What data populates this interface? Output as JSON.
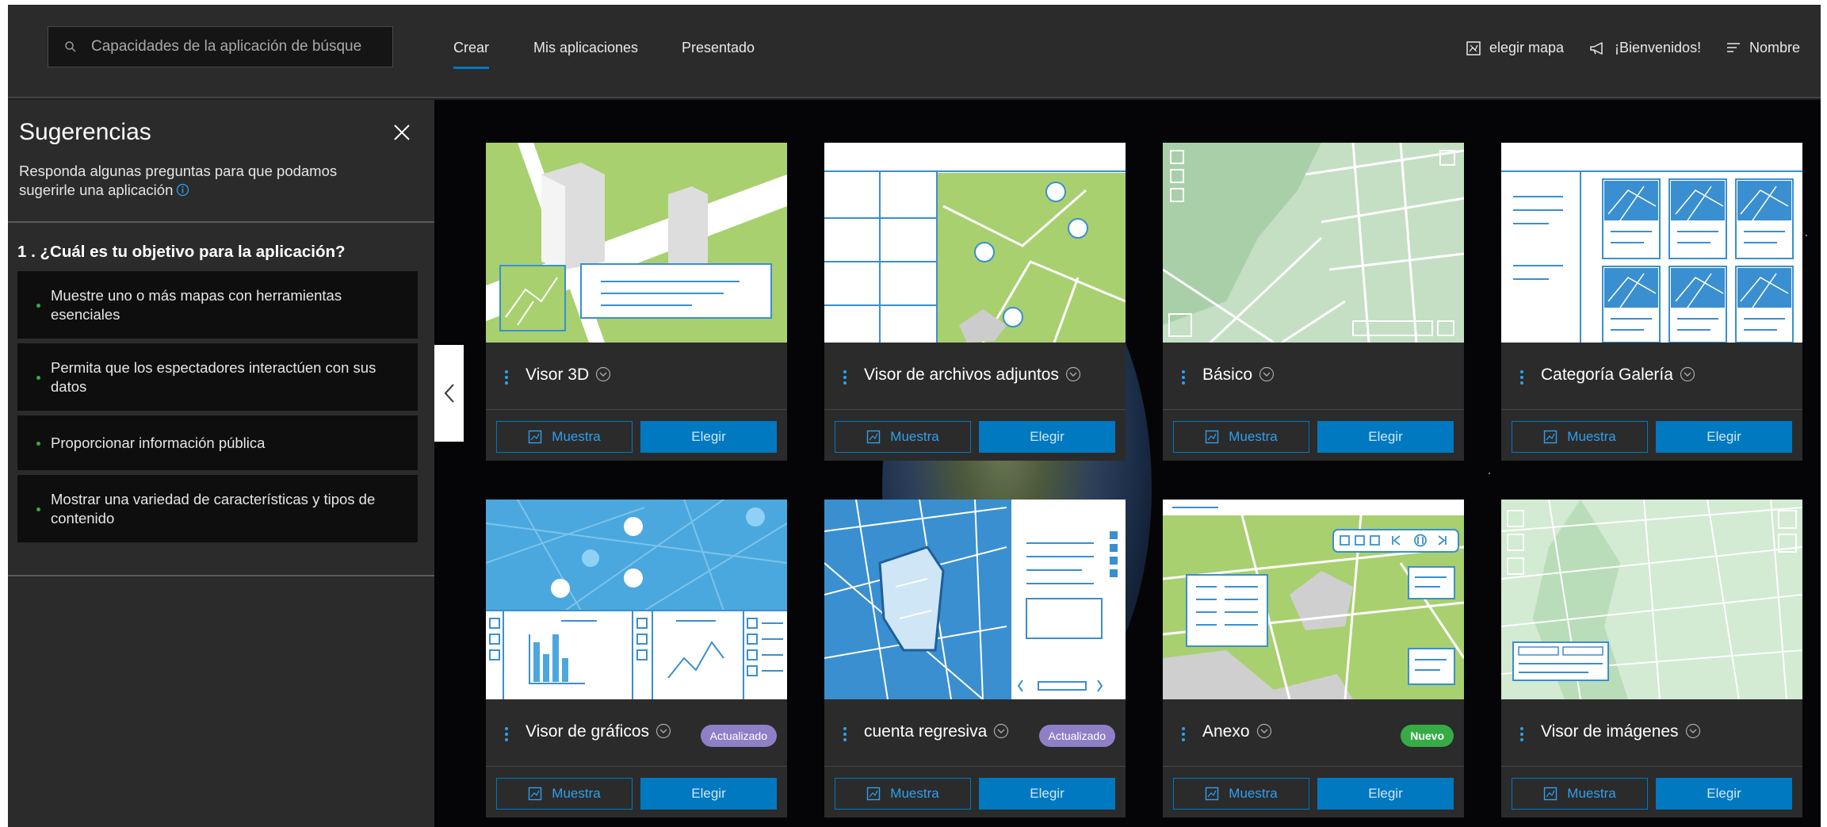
{
  "header": {
    "search_placeholder": "Capacidades de la aplicación de búsque",
    "tabs": [
      {
        "label": "Crear",
        "active": true
      },
      {
        "label": "Mis aplicaciones",
        "active": false
      },
      {
        "label": "Presentado",
        "active": false
      }
    ],
    "choose_map_label": "elegir mapa",
    "welcome_label": "¡Bienvenidos!",
    "sort_label": "Nombre"
  },
  "sidebar": {
    "title": "Sugerencias",
    "description": "Responda algunas preguntas para que podamos sugerirle una aplicación",
    "question": "1 . ¿Cuál es tu objetivo para la aplicación?",
    "options": [
      "Muestre uno o más mapas con herramientas esenciales",
      "Permita que los espectadores interactúen con sus datos",
      "Proporcionar información pública",
      "Mostrar una variedad de características y tipos de contenido"
    ]
  },
  "cards": [
    {
      "title": "Visor 3D",
      "badge": "",
      "sample_label": "Muestra",
      "choose_label": "Elegir"
    },
    {
      "title": "Visor de archivos adjuntos",
      "badge": "",
      "sample_label": "Muestra",
      "choose_label": "Elegir"
    },
    {
      "title": "Básico",
      "badge": "",
      "sample_label": "Muestra",
      "choose_label": "Elegir"
    },
    {
      "title": "Categoría Galería",
      "badge": "",
      "sample_label": "Muestra",
      "choose_label": "Elegir"
    },
    {
      "title": "Visor de gráficos",
      "badge": "Actualizado",
      "sample_label": "Muestra",
      "choose_label": "Elegir"
    },
    {
      "title": "cuenta regresiva",
      "badge": "Actualizado",
      "sample_label": "Muestra",
      "choose_label": "Elegir"
    },
    {
      "title": "Anexo",
      "badge": "Nuevo",
      "sample_label": "Muestra",
      "choose_label": "Elegir"
    },
    {
      "title": "Visor de imágenes",
      "badge": "",
      "sample_label": "Muestra",
      "choose_label": "Elegir"
    }
  ],
  "icons": {
    "search": "search-icon",
    "map": "map-icon",
    "megaphone": "megaphone-icon",
    "sort": "sort-icon",
    "close": "close-icon",
    "info": "info-icon",
    "kebab": "kebab-icon",
    "chevron": "chevron-down-icon",
    "collapse": "chevron-left-icon"
  },
  "colors": {
    "accent": "#0079c1",
    "updated_badge": "#8f7fc7",
    "new_badge": "#35ac46",
    "background": "#2b2b2b"
  }
}
